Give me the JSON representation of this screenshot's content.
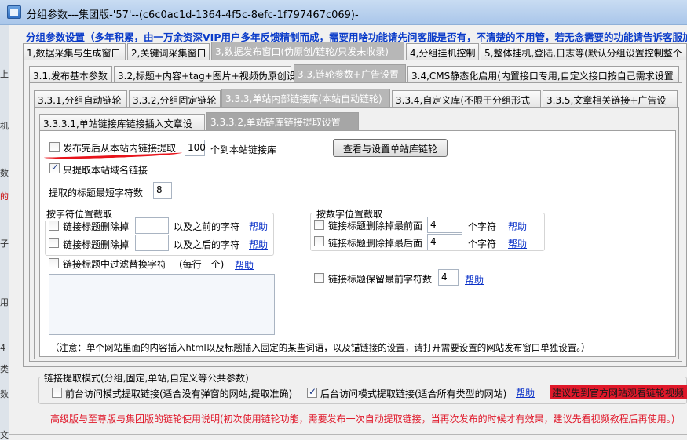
{
  "window": {
    "title": "分组参数---集团版-'57'--(c6c0ac1d-1364-4f5c-8efc-1f797467c069)-"
  },
  "left_strip": {
    "chars": [
      "上",
      "机",
      "数",
      "的",
      "子",
      "用",
      "4",
      "类",
      "数",
      "文"
    ]
  },
  "notice": "分组参数设置（多年积累，由一万余资深VIP用户多年反馈精制而成，需要用啥功能请先问客服是否有，不清楚的不用管，若无念需要的功能请告诉客服加",
  "tabs_level1": [
    {
      "label": "1,数据采集与生成窗口"
    },
    {
      "label": "2,关键词采集窗口"
    },
    {
      "label": "3,数据发布窗口(伪原创/链轮/只发未收录)"
    },
    {
      "label": "4,分组挂机控制"
    },
    {
      "label": "5,整体挂机,登陆,日志等(默认分组设置控制整个"
    }
  ],
  "tabs_level2": [
    {
      "label": "3.1,发布基本参数"
    },
    {
      "label": "3.2,标题+内容+tag+图片+视频伪原创设"
    },
    {
      "label": "3.3,链轮参数+广告设置"
    },
    {
      "label": "3.4,CMS静态化启用(内置接口专用,自定义接口按自己需求设置"
    }
  ],
  "tabs_level3": [
    {
      "label": "3.3.1,分组自动链轮"
    },
    {
      "label": "3.3.2,分组固定链轮"
    },
    {
      "label": "3.3.3,单站内部链接库(本站自动链轮)"
    },
    {
      "label": "3.3.4,自定义库(不限于分组形式"
    },
    {
      "label": "3.3.5,文章相关链接+广告设"
    }
  ],
  "tabs_level4": [
    {
      "label": "3.3.3.1,单站链接库链接插入文章设"
    },
    {
      "label": "3.3.3.2,单站链库链接提取设置"
    }
  ],
  "extract": {
    "after_publish_label": "发布完后从本站内链接提取",
    "count_value": "100",
    "count_suffix": "个到本站链接库",
    "view_button": "查看与设置单站库链轮",
    "only_domain_label": "只提取本站域名链接",
    "min_title_label": "提取的标题最短字符数",
    "min_title_value": "8"
  },
  "char_pos": {
    "title": "按字符位置截取",
    "row1_label": "链接标题删除掉",
    "row1_suffix": "以及之前的字符",
    "row2_label": "链接标题删除掉",
    "row2_suffix": "以及之后的字符",
    "help": "帮助"
  },
  "num_pos": {
    "title": "按数字位置截取",
    "row1_label": "链接标题删除掉最前面",
    "row1_value": "4",
    "row2_label": "链接标题删除掉最后面",
    "row2_value": "4",
    "unit": "个字符",
    "help": "帮助"
  },
  "filter": {
    "label": "链接标题中过滤替换字符",
    "hint": "(每行一个)",
    "help": "帮助"
  },
  "keep_front": {
    "label": "链接标题保留最前字符数",
    "value": "4",
    "help": "帮助"
  },
  "note": "（注意：单个网站里面的内容插入html以及标题插入固定的某些词语，以及锚链接的设置，请打开需要设置的网站发布窗口单独设置。）",
  "mode": {
    "title": "链接提取模式(分组,固定,单站,自定义等公共参数)",
    "front_label": "前台访问模式提取链接(适合没有弹窗的网站,提取准确)",
    "back_label": "后台访问模式提取链接(适合所有类型的网站)",
    "help": "帮助",
    "advice": "建议先到官方网站观看链轮视频"
  },
  "footer_warning": "高级版与至尊版与集团版的链轮使用说明(初次使用链轮功能，需要发布一次自动提取链接，当再次发布的时候才有效果，建议先看视频教程后再使用。)",
  "colors": {
    "notice_blue": "#0b3cc9",
    "link_blue": "#0a31c8",
    "warning_red": "#e0182a",
    "advice_bg": "#e0182a",
    "underline_red": "#e8141c"
  }
}
